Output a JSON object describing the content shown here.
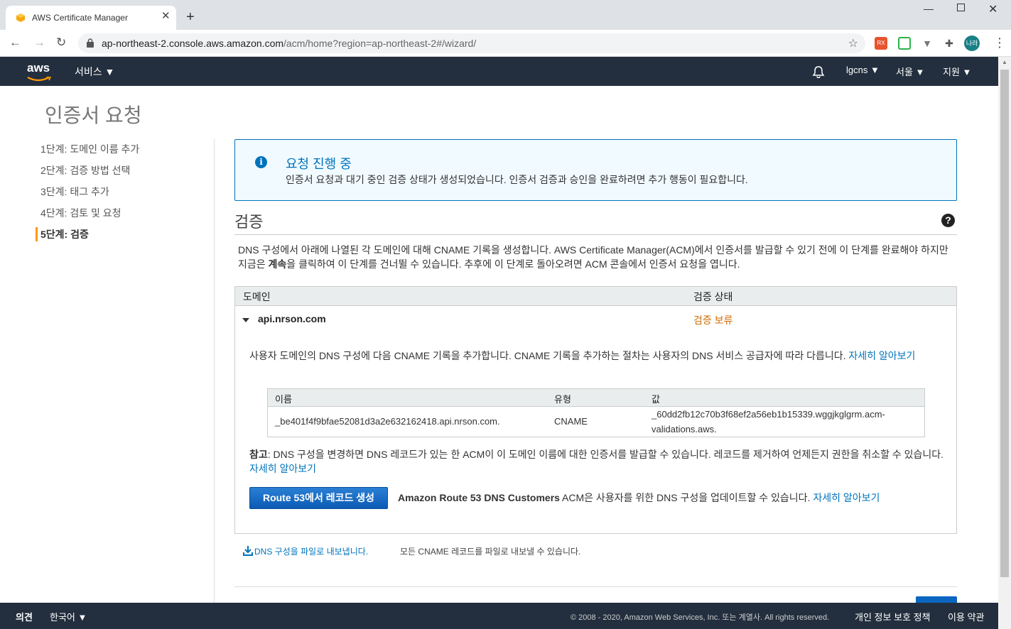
{
  "browser": {
    "tab_title": "AWS Certificate Manager",
    "new_tab": "+",
    "close_tab": "✕",
    "url_host": "ap-northeast-2.console.aws.amazon.com",
    "url_path": "/acm/home?region=ap-northeast-2#/wizard/",
    "profile": "나라",
    "extensions": [
      "RX",
      "screen-icon",
      "v-icon",
      "puzzle-icon"
    ]
  },
  "aws_header": {
    "logo": "aws",
    "services": "서비스",
    "account": "lgcns",
    "region": "서울",
    "support": "지원"
  },
  "page": {
    "title": "인증서 요청",
    "steps": [
      {
        "label": "1단계: 도메인 이름 추가"
      },
      {
        "label": "2단계: 검증 방법 선택"
      },
      {
        "label": "3단계: 태그 추가"
      },
      {
        "label": "4단계: 검토 및 요청"
      },
      {
        "label": "5단계: 검증",
        "active": true
      }
    ]
  },
  "alert": {
    "title": "요청 진행 중",
    "body": "인증서 요청과 대기 중인 검증 상태가 생성되었습니다. 인증서 검증과 승인을 완료하려면 추가 행동이 필요합니다."
  },
  "validation": {
    "title": "검증",
    "desc_part1": "DNS 구성에서 아래에 나열된 각 도메인에 대해 CNAME 기록을 생성합니다. AWS Certificate Manager(ACM)에서 인증서를 발급할 수 있기 전에 이 단계를 완료해야 하지만 지금은 ",
    "desc_bold": "계속",
    "desc_part2": "을 클릭하여 이 단계를 건너뛸 수 있습니다. 추후에 이 단계로 돌아오려면 ACM 콘솔에서 인증서 요청을 엽니다.",
    "col_domain": "도메인",
    "col_status": "검증 상태",
    "domain": "api.nrson.com",
    "status": "검증 보류",
    "info": "사용자 도메인의 DNS 구성에 다음 CNAME 기록을 추가합니다. CNAME 기록을 추가하는 절차는 사용자의 DNS 서비스 공급자에 따라 다릅니다. ",
    "info_link": "자세히 알아보기",
    "cname": {
      "col_name": "이름",
      "col_type": "유형",
      "col_value": "값",
      "name": "_be401f4f9bfae52081d3a2e632162418.api.nrson.com.",
      "type": "CNAME",
      "value_line1": "_60dd2fb12c70b3f68ef2a56eb1b15339.wggjkglgrm.acm-",
      "value_line2": "validations.aws."
    },
    "note_bold": "참고",
    "note": ": DNS 구성을 변경하면 DNS 레코드가 있는 한 ACM이 이 도메인 이름에 대한 인증서를 발급할 수 있습니다. 레코드를 제거하여 언제든지 권한을 취소할 수 있습니다. ",
    "note_link": "자세히 알아보기",
    "r53_button": "Route 53에서 레코드 생성",
    "r53_bold": "Amazon Route 53 DNS Customers",
    "r53_text": " ACM은 사용자를 위한 DNS 구성을 업데이트할 수 있습니다. ",
    "r53_link": "자세히 알아보기"
  },
  "export": {
    "link": "DNS 구성을 파일로 내보냅니다.",
    "desc": "모든 CNAME 레코드를 파일로 내보낼 수 있습니다."
  },
  "footer": {
    "feedback": "의견",
    "language": "한국어",
    "copyright": "© 2008 - 2020, Amazon Web Services, Inc. 또는 계열사. All rights reserved.",
    "privacy": "개인 정보 보호 정책",
    "terms": "이용 약관"
  },
  "colors": {
    "aws_dark": "#232f3e",
    "link": "#0073bb",
    "pending": "#d06b00",
    "accent": "#ff9900"
  }
}
